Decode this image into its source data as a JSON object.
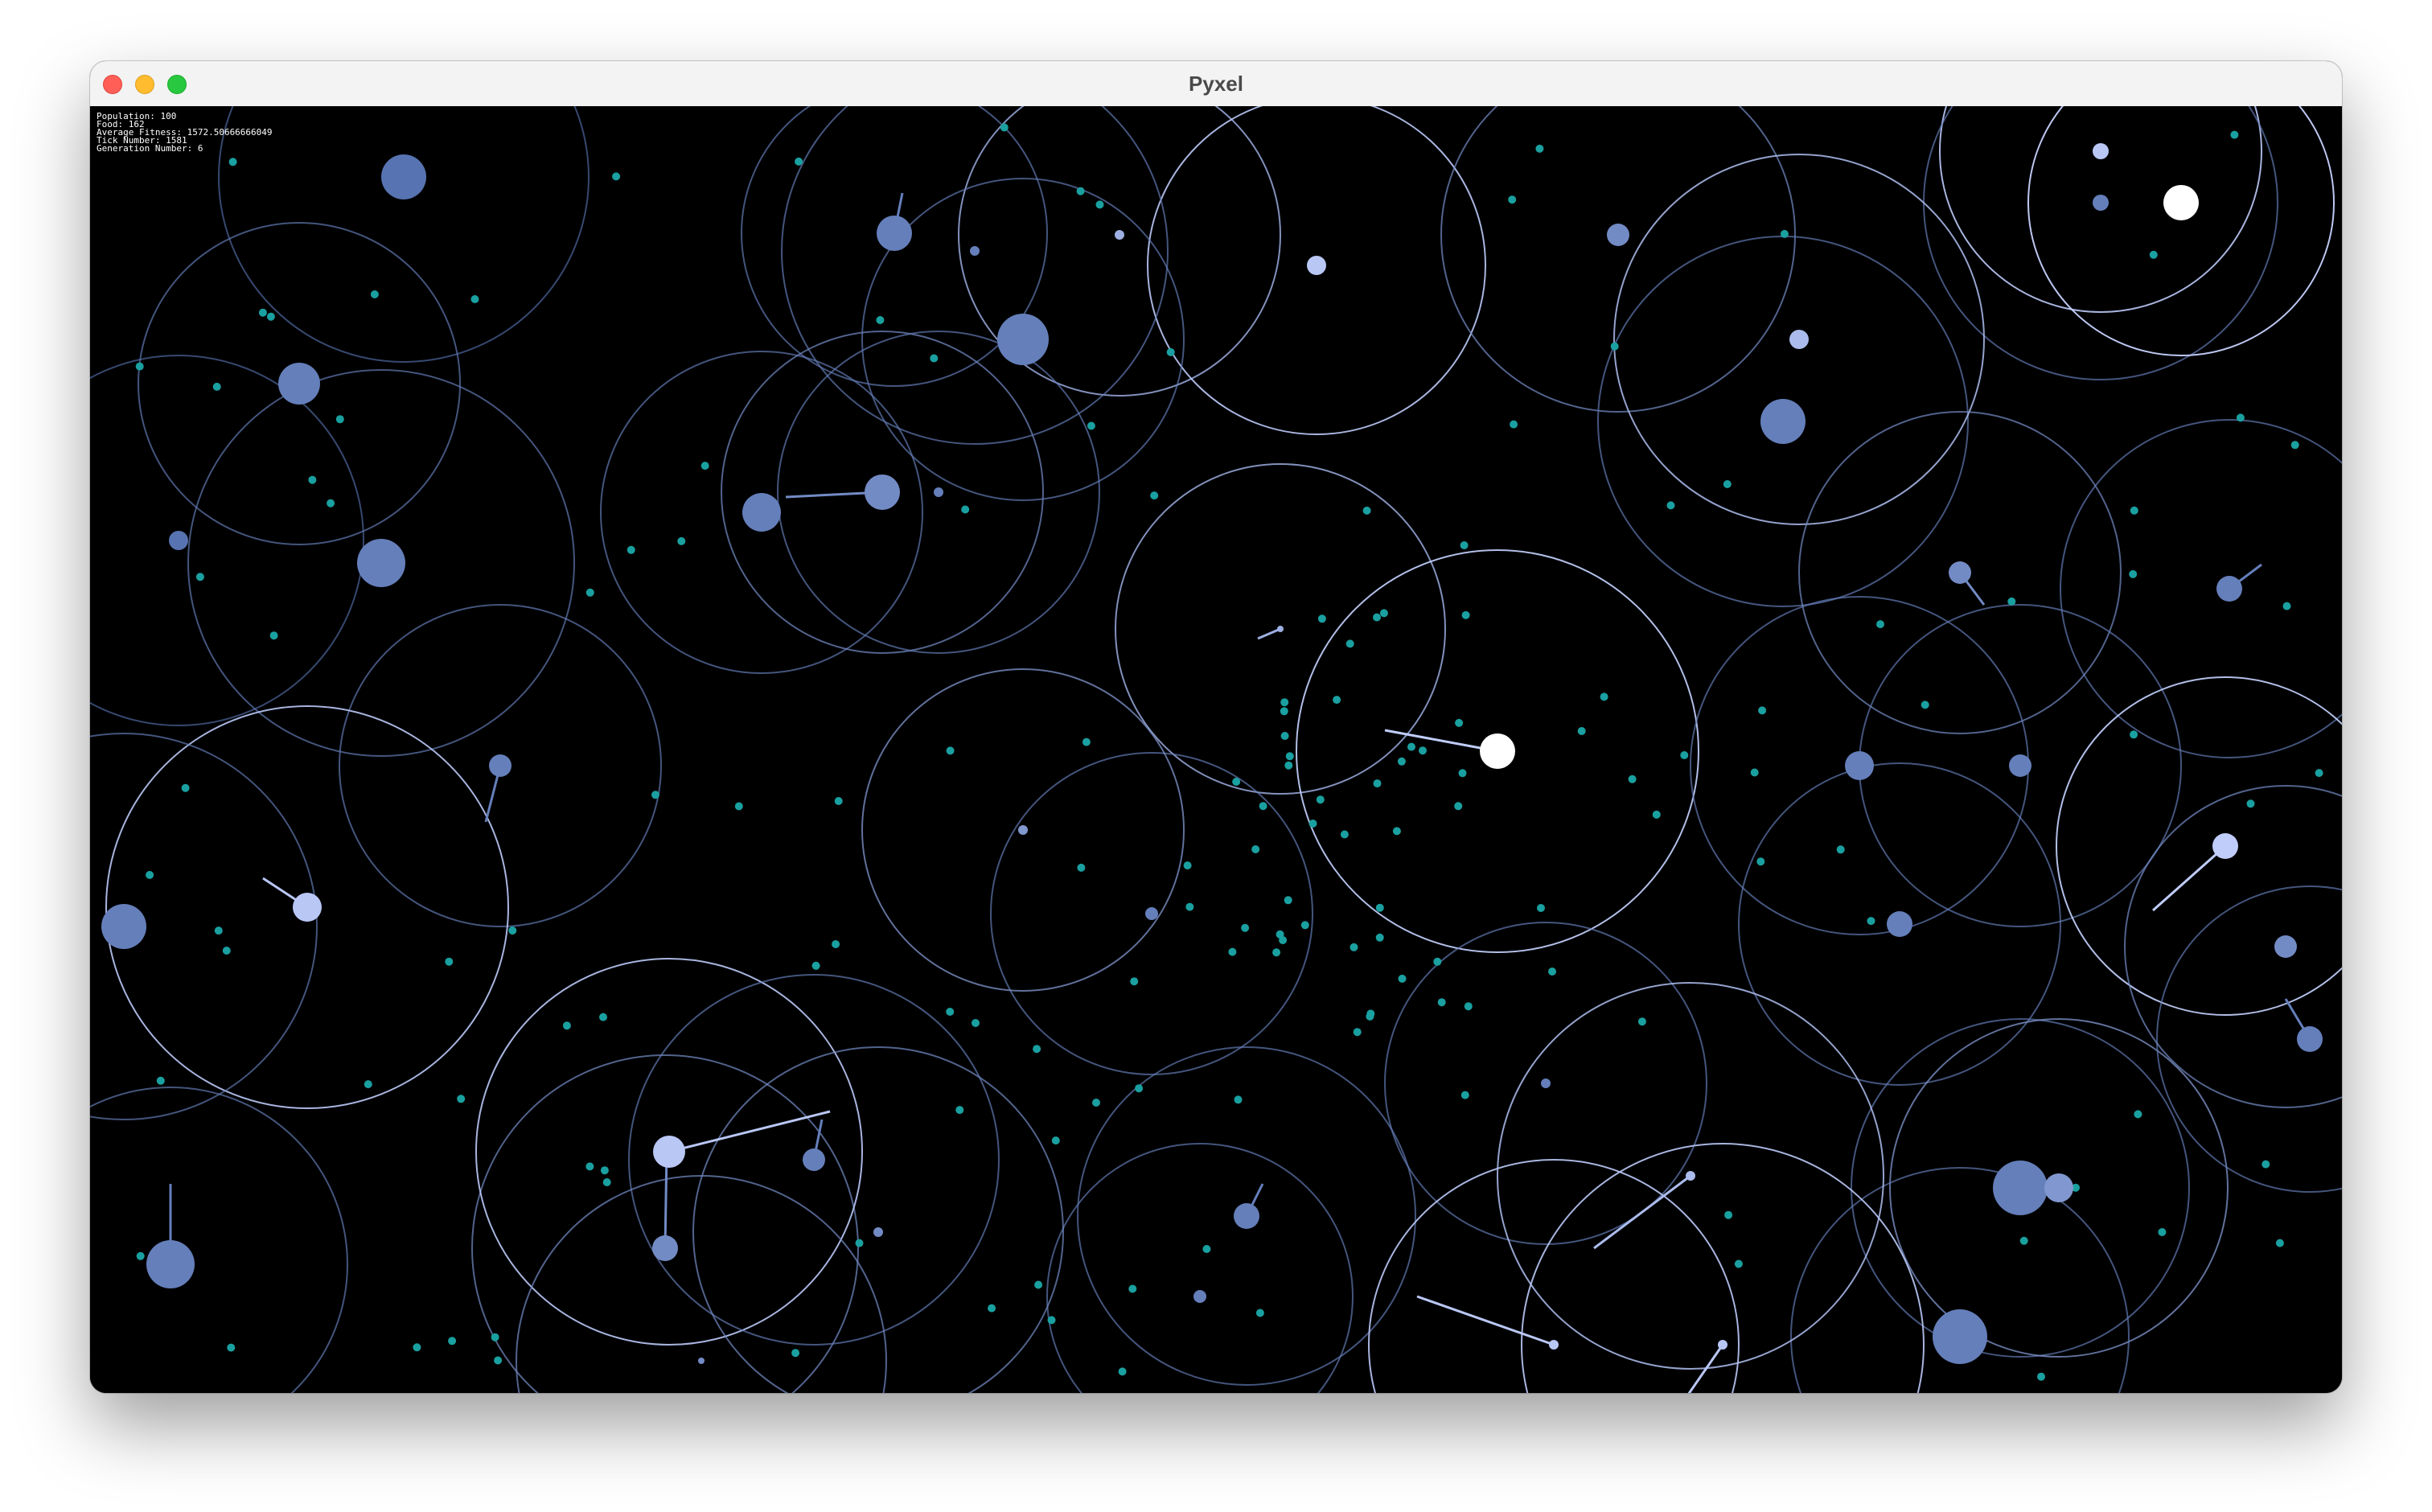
{
  "window": {
    "title": "Pyxel"
  },
  "hud": {
    "population": "Population: 100",
    "food": "Food: 162",
    "average_fitness": "Average Fitness: 1572.50666666049",
    "tick_number": "Tick Number: 1581",
    "generation_number": "Generation Number: 6"
  },
  "colors": {
    "background": "#000000",
    "food": "#1aa0a0",
    "creature": "#3b5b9e",
    "creature_bright": "#c7d3ff",
    "sense_ring": "#3b5b9e"
  }
}
